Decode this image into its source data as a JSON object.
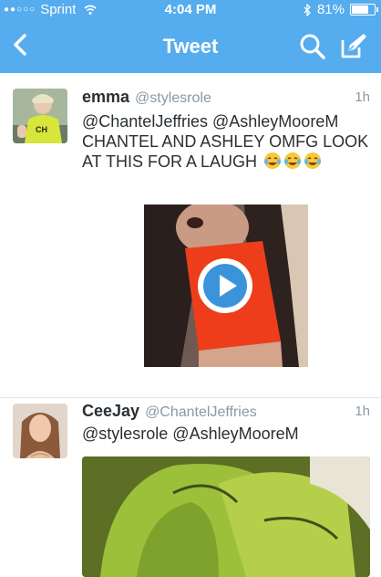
{
  "status_bar": {
    "carrier": "Sprint",
    "time": "4:04 PM",
    "battery": "81%",
    "battery_level": 0.81
  },
  "nav": {
    "title": "Tweet",
    "icons": [
      "back-chevron-icon",
      "search-icon",
      "compose-icon"
    ]
  },
  "tweets": [
    {
      "name": "emma",
      "handle": "@stylesrole",
      "time": "1h",
      "text": "@ChantelJeffries @AshleyMooreM CHANTEL AND ASHLEY OMFG LOOK AT THIS FOR A LAUGH",
      "emoji": [
        "face-with-tears-of-joy",
        "face-with-tears-of-joy",
        "face-with-tears-of-joy"
      ],
      "media": "video"
    },
    {
      "name": "CeeJay",
      "handle": "@ChantelJeffries",
      "time": "1h",
      "text": "@stylesrole @AshleyMooreM",
      "media": "image"
    }
  ],
  "colors": {
    "accent": "#55acee",
    "text": "#292f33",
    "muted": "#8899a6",
    "play": "#3b94d9"
  }
}
